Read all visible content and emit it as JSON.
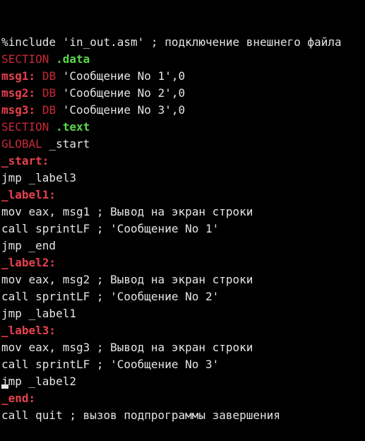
{
  "lines": [
    {
      "parts": [
        {
          "t": "%include 'in_out.asm' ; подключение внешнего файла",
          "c": "plain"
        }
      ]
    },
    {
      "parts": [
        {
          "t": "SECTION ",
          "c": "red"
        },
        {
          "t": ".data",
          "c": "green"
        }
      ]
    },
    {
      "parts": [
        {
          "t": "msg1:",
          "c": "redb"
        },
        {
          "t": " ",
          "c": "plain"
        },
        {
          "t": "DB",
          "c": "red"
        },
        {
          "t": " 'Сообщение No 1',0",
          "c": "plain"
        }
      ]
    },
    {
      "parts": [
        {
          "t": "msg2:",
          "c": "redb"
        },
        {
          "t": " ",
          "c": "plain"
        },
        {
          "t": "DB",
          "c": "red"
        },
        {
          "t": " 'Сообщение No 2',0",
          "c": "plain"
        }
      ]
    },
    {
      "parts": [
        {
          "t": "msg3:",
          "c": "redb"
        },
        {
          "t": " ",
          "c": "plain"
        },
        {
          "t": "DB",
          "c": "red"
        },
        {
          "t": " 'Сообщение No 3',0",
          "c": "plain"
        }
      ]
    },
    {
      "parts": [
        {
          "t": "SECTION ",
          "c": "red"
        },
        {
          "t": ".text",
          "c": "green"
        }
      ]
    },
    {
      "parts": [
        {
          "t": "GLOBAL",
          "c": "red"
        },
        {
          "t": " _start",
          "c": "plain"
        }
      ]
    },
    {
      "parts": [
        {
          "t": "_start:",
          "c": "redb"
        }
      ]
    },
    {
      "parts": [
        {
          "t": "jmp _label3",
          "c": "plain"
        }
      ]
    },
    {
      "parts": [
        {
          "t": "_label1:",
          "c": "redb"
        }
      ]
    },
    {
      "parts": [
        {
          "t": "mov eax, msg1 ; Вывод на экран строки",
          "c": "plain"
        }
      ]
    },
    {
      "parts": [
        {
          "t": "call sprintLF ; 'Сообщение No 1'",
          "c": "plain"
        }
      ]
    },
    {
      "parts": [
        {
          "t": "jmp _end",
          "c": "plain"
        }
      ]
    },
    {
      "parts": [
        {
          "t": "_label2:",
          "c": "redb"
        }
      ]
    },
    {
      "parts": [
        {
          "t": "mov eax, msg2 ; Вывод на экран строки",
          "c": "plain"
        }
      ]
    },
    {
      "parts": [
        {
          "t": "call sprintLF ; 'Сообщение No 2'",
          "c": "plain"
        }
      ]
    },
    {
      "parts": [
        {
          "t": "jmp _label1",
          "c": "plain"
        }
      ]
    },
    {
      "parts": [
        {
          "t": "_label3:",
          "c": "redb"
        }
      ]
    },
    {
      "parts": [
        {
          "t": "mov eax, msg3 ; Вывод на экран строки",
          "c": "plain"
        }
      ]
    },
    {
      "parts": [
        {
          "t": "call sprintLF ; 'Сообщение No 3'",
          "c": "plain"
        }
      ]
    },
    {
      "parts": [
        {
          "t": "jmp _label2",
          "c": "plain"
        }
      ]
    },
    {
      "parts": [
        {
          "t": "_end:",
          "c": "redb"
        }
      ]
    },
    {
      "parts": [
        {
          "t": "call quit ; вызов подпрограммы завершения",
          "c": "plain"
        }
      ]
    }
  ],
  "colors": {
    "background": "#000000",
    "text": "#e5e5e5",
    "keyword_red": "#c82836",
    "label_red": "#e8414e",
    "section_green": "#5ad84a"
  }
}
